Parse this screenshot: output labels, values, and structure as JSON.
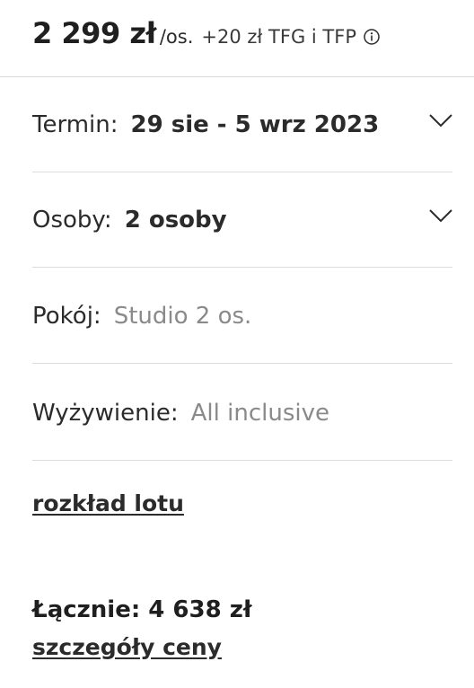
{
  "price": {
    "amount": "2 299 zł",
    "per_person": "/os.",
    "extra_fees": "+20 zł TFG i TFP",
    "info_icon": "info-circle-icon"
  },
  "booking": {
    "date": {
      "label": "Termin:",
      "value": "29 sie - 5 wrz 2023",
      "icon": "chevron-down-icon"
    },
    "people": {
      "label": "Osoby:",
      "value": "2 osoby",
      "icon": "chevron-down-icon"
    },
    "room": {
      "label": "Pokój:",
      "value": "Studio 2 os."
    },
    "board": {
      "label": "Wyżywienie:",
      "value": "All inclusive"
    }
  },
  "links": {
    "flight_schedule": "rozkład lotu",
    "price_details": "szczegóły ceny"
  },
  "total": {
    "text": "Łącznie: 4 638 zł"
  }
}
